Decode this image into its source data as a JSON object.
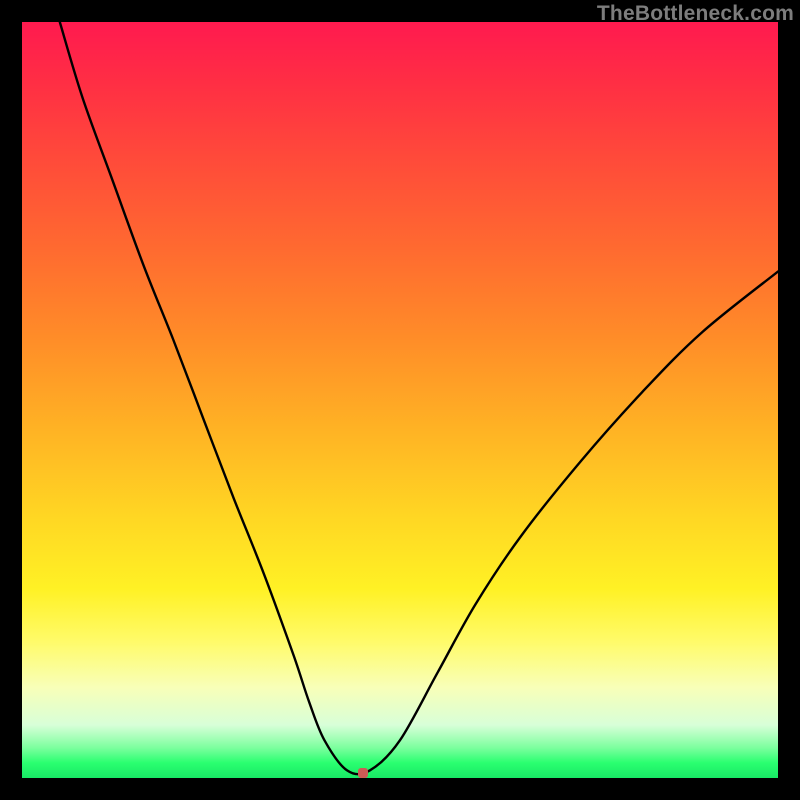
{
  "watermark": "TheBottleneck.com",
  "marker": {
    "color": "#cc5a55",
    "x_frac": 0.451,
    "y_frac": 0.993
  },
  "chart_data": {
    "type": "line",
    "title": "",
    "xlabel": "",
    "ylabel": "",
    "xlim": [
      0,
      100
    ],
    "ylim": [
      0,
      100
    ],
    "grid": false,
    "legend": false,
    "series": [
      {
        "name": "bottleneck-curve",
        "x": [
          5.0,
          8.0,
          12.0,
          16.0,
          20.0,
          24.0,
          28.0,
          32.0,
          36.0,
          38.0,
          40.0,
          43.0,
          46.0,
          50.0,
          55.0,
          60.0,
          66.0,
          74.0,
          82.0,
          90.0,
          100.0
        ],
        "y": [
          100.0,
          90.0,
          79.0,
          68.0,
          58.0,
          47.5,
          37.0,
          27.0,
          16.0,
          10.0,
          5.0,
          1.0,
          1.0,
          5.0,
          14.0,
          23.0,
          32.0,
          42.0,
          51.0,
          59.0,
          67.0
        ]
      }
    ],
    "annotations": [
      {
        "type": "marker",
        "x": 45.1,
        "y": 0.7,
        "label": "optimal-point"
      }
    ],
    "background_gradient": {
      "direction": "vertical",
      "stops": [
        {
          "pos": 0.0,
          "color": "#ff1a4f"
        },
        {
          "pos": 0.5,
          "color": "#ffc224"
        },
        {
          "pos": 0.8,
          "color": "#fffb6a"
        },
        {
          "pos": 1.0,
          "color": "#18e865"
        }
      ]
    }
  }
}
